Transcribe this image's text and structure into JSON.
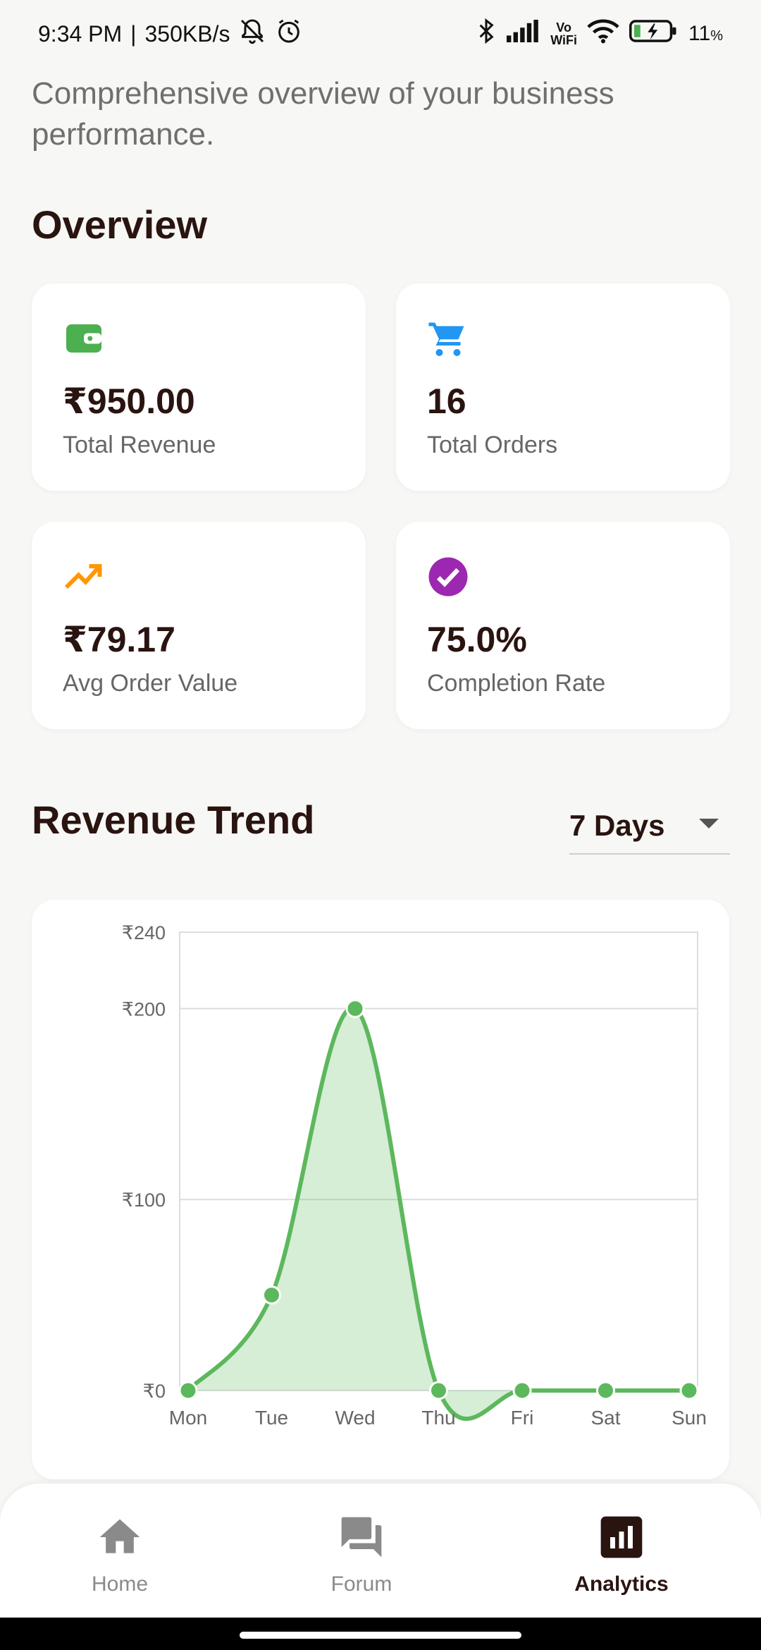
{
  "status_bar": {
    "time": "9:34 PM",
    "speed": "350KB/s",
    "volte": "Vo\nWiFi",
    "battery": "11",
    "battery_unit": "%"
  },
  "header": {
    "subtitle": "Comprehensive overview of your business performance."
  },
  "overview": {
    "title": "Overview",
    "cards": [
      {
        "value": "₹950.00",
        "label": "Total Revenue",
        "icon": "wallet-icon",
        "color": "#4caf50"
      },
      {
        "value": "16",
        "label": "Total Orders",
        "icon": "cart-icon",
        "color": "#2196f3"
      },
      {
        "value": "₹79.17",
        "label": "Avg Order Value",
        "icon": "trending-up-icon",
        "color": "#ff9800"
      },
      {
        "value": "75.0%",
        "label": "Completion Rate",
        "icon": "check-circle-icon",
        "color": "#9c27b0"
      }
    ]
  },
  "revenue_trend": {
    "title": "Revenue Trend",
    "range_selected": "7 Days"
  },
  "chart_data": {
    "type": "area",
    "categories": [
      "Mon",
      "Tue",
      "Wed",
      "Thu",
      "Fri",
      "Sat",
      "Sun"
    ],
    "values": [
      0,
      50,
      200,
      0,
      0,
      0,
      0
    ],
    "ytick_labels": [
      "₹0",
      "₹100",
      "₹200",
      "₹240"
    ],
    "ytick_values": [
      0,
      100,
      200,
      240
    ],
    "ylim": [
      0,
      240
    ],
    "grid": true,
    "line_color": "#5cb85c"
  },
  "bottom_nav": {
    "items": [
      {
        "label": "Home",
        "icon": "home-icon"
      },
      {
        "label": "Forum",
        "icon": "forum-icon"
      },
      {
        "label": "Analytics",
        "icon": "analytics-icon"
      }
    ],
    "active": "Analytics"
  }
}
